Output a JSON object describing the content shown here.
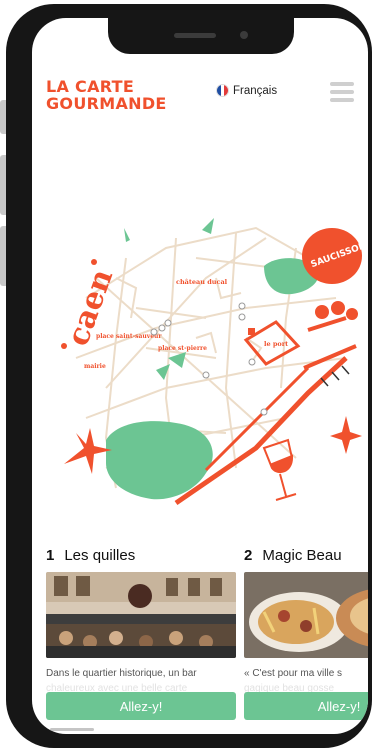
{
  "header": {
    "brand_line1": "LA CARTE",
    "brand_line2": "GOURMANDE",
    "language": "Français"
  },
  "map": {
    "city": "caen",
    "labels": [
      "château ducal",
      "le port",
      "place saint-sauveur",
      "place st-pierre",
      "mairie"
    ],
    "sticker": "SAUCISSON",
    "colors": {
      "orange": "#f0512d",
      "green": "#6cc593",
      "street": "#ecdcc8"
    }
  },
  "cards": [
    {
      "number": "1",
      "name": "Les quilles",
      "description": "Dans le quartier historique, un bar",
      "description_faded": "chaleureux avec une belle carte",
      "cta": "Allez-y!"
    },
    {
      "number": "2",
      "name": "Magic Beau",
      "description": "« C'est pour ma ville s",
      "description_faded": "gagique beau gosse",
      "cta": "Allez-y!"
    }
  ]
}
